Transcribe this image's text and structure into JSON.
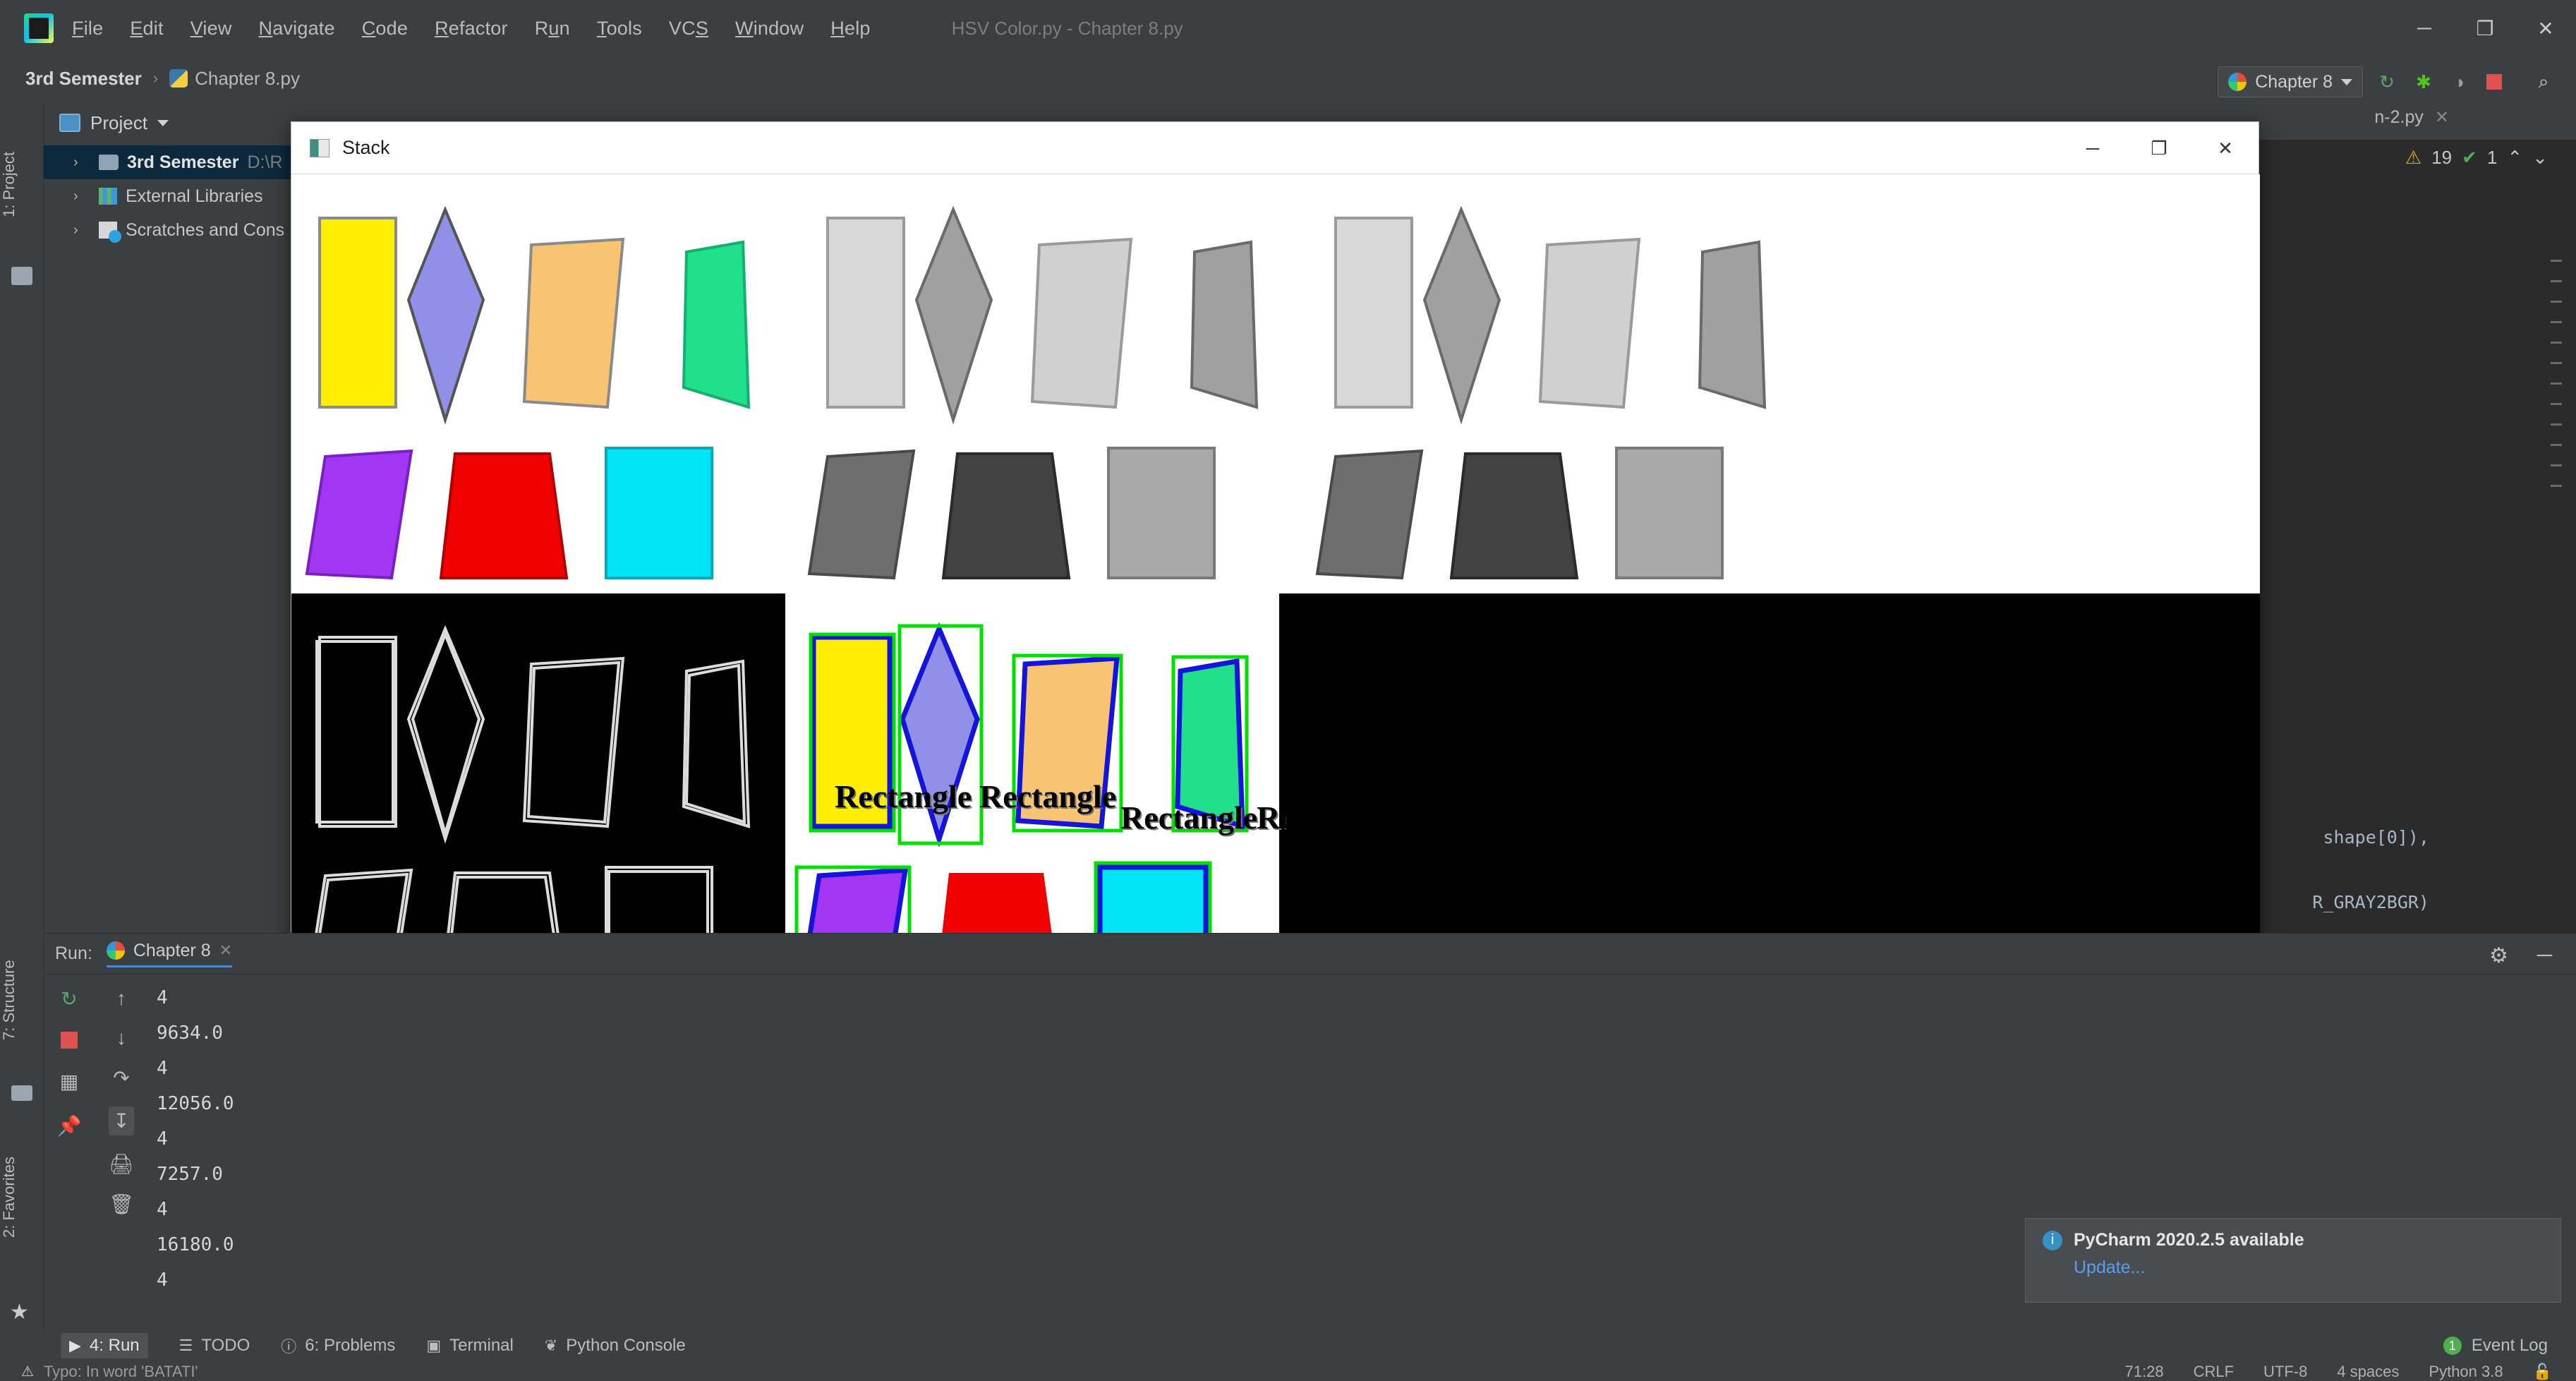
{
  "app": {
    "window_title": "HSV Color.py - Chapter 8.py",
    "logo_icon": "pycharm-logo-icon",
    "menu": [
      {
        "label": "File",
        "mnemonic": "F"
      },
      {
        "label": "Edit",
        "mnemonic": "E"
      },
      {
        "label": "View",
        "mnemonic": "V"
      },
      {
        "label": "Navigate",
        "mnemonic": "N"
      },
      {
        "label": "Code",
        "mnemonic": "C"
      },
      {
        "label": "Refactor",
        "mnemonic": "R"
      },
      {
        "label": "Run",
        "mnemonic": "u"
      },
      {
        "label": "Tools",
        "mnemonic": "T"
      },
      {
        "label": "VCS",
        "mnemonic": "S"
      },
      {
        "label": "Window",
        "mnemonic": "W"
      },
      {
        "label": "Help",
        "mnemonic": "H"
      }
    ],
    "window_buttons": {
      "minimize": "─",
      "maximize": "❐",
      "close": "✕"
    }
  },
  "navbar": {
    "root": "3rd Semester",
    "separator": "›",
    "file": "Chapter 8.py",
    "run_config": {
      "label": "Chapter 8",
      "icon": "python-config-icon",
      "caret": "▾"
    },
    "toolbar": {
      "run": "↻",
      "debug": "✱",
      "coverage": "◑",
      "stop": "stop-icon",
      "search": "⌕"
    }
  },
  "toolstrip": {
    "project_tab": "1: Project",
    "structure_tab": "7: Structure",
    "favorites_tab": "2: Favorites",
    "star_icon": "★"
  },
  "project": {
    "title": "Project",
    "caret": "▾",
    "tree": [
      {
        "chevron": "›",
        "icon": "folder-icon",
        "name": "3rd Semester",
        "path": "D:\\R",
        "selected": true
      },
      {
        "chevron": "›",
        "icon": "library-icon",
        "name": "External Libraries",
        "path": "",
        "selected": false
      },
      {
        "chevron": "›",
        "icon": "scratches-icon",
        "name": "Scratches and Cons",
        "path": "",
        "selected": false
      }
    ]
  },
  "editor": {
    "tab": {
      "label": "n-2.py",
      "close": "✕"
    },
    "inspection": {
      "warn_icon": "⚠",
      "warn_count": "19",
      "ok_icon": "✔",
      "ok_count": "1",
      "up": "⌃",
      "down": "⌄"
    },
    "code_fragments": [
      "shape[0]),",
      "R_GRAY2BGR)"
    ]
  },
  "stack_window": {
    "title": "Stack",
    "icon": "image-window-icon",
    "buttons": {
      "minimize": "─",
      "maximize": "❐",
      "close": "✕"
    },
    "panels": [
      {
        "name": "original-color-shapes",
        "background": "#ffffff"
      },
      {
        "name": "grayscale-shapes",
        "background": "#ffffff"
      },
      {
        "name": "canny-edges",
        "background": "#000000"
      },
      {
        "name": "detected-contours",
        "background": "#ffffff"
      },
      {
        "name": "empty-black",
        "background": "#000000"
      }
    ],
    "shape_label": "Rectangle",
    "label_count": 6,
    "colors": {
      "yellow": "#ffee00",
      "periwinkle": "#9090e8",
      "orange": "#f8c471",
      "spring_green": "#20e08a",
      "purple": "#a335f5",
      "red": "#f00000",
      "cyan": "#00e5f5",
      "contour_blue": "#1414dc",
      "bbox_green": "#00e000",
      "gray_light": "#d8d8d8",
      "gray_mid": "#a0a0a0",
      "gray_dark": "#6e6e6e",
      "gray_darker": "#424242",
      "edge_white": "#dcdcdc"
    }
  },
  "run_window": {
    "label": "Run:",
    "tab": {
      "label": "Chapter 8",
      "icon": "python-run-icon",
      "close": "✕"
    },
    "gear_icon": "⚙",
    "minimize_icon": "─",
    "left_icons": [
      "rerun-icon",
      "stop-icon",
      "layout-icon",
      "pin-icon"
    ],
    "second_icons": [
      "scroll-up-icon",
      "scroll-down-icon",
      "soft-wrap-icon",
      "scroll-to-end-icon",
      "print-icon",
      "trash-icon"
    ],
    "console_lines": [
      "4",
      "9634.0",
      "4",
      "12056.0",
      "4",
      "7257.0",
      "4",
      "16180.0",
      "4"
    ]
  },
  "notification": {
    "icon": "info-icon",
    "icon_glyph": "i",
    "title": "PyCharm 2020.2.5 available",
    "link": "Update..."
  },
  "bottom_bar": {
    "items": [
      {
        "icon": "▶",
        "label": "4: Run",
        "active": true
      },
      {
        "icon": "☰",
        "label": "TODO",
        "active": false
      },
      {
        "icon": "ⓘ",
        "label": "6: Problems",
        "active": false
      },
      {
        "icon": "▣",
        "label": "Terminal",
        "active": false
      },
      {
        "icon": "❦",
        "label": "Python Console",
        "active": false
      }
    ],
    "event_log": {
      "count": "1",
      "label": "Event Log"
    }
  },
  "status_bar": {
    "message": "Typo: In word 'BATATI'",
    "caret": "71:28",
    "line_sep": "CRLF",
    "encoding": "UTF-8",
    "indent": "4 spaces",
    "interpreter": "Python 3.8",
    "lock_icon": "🔓"
  }
}
